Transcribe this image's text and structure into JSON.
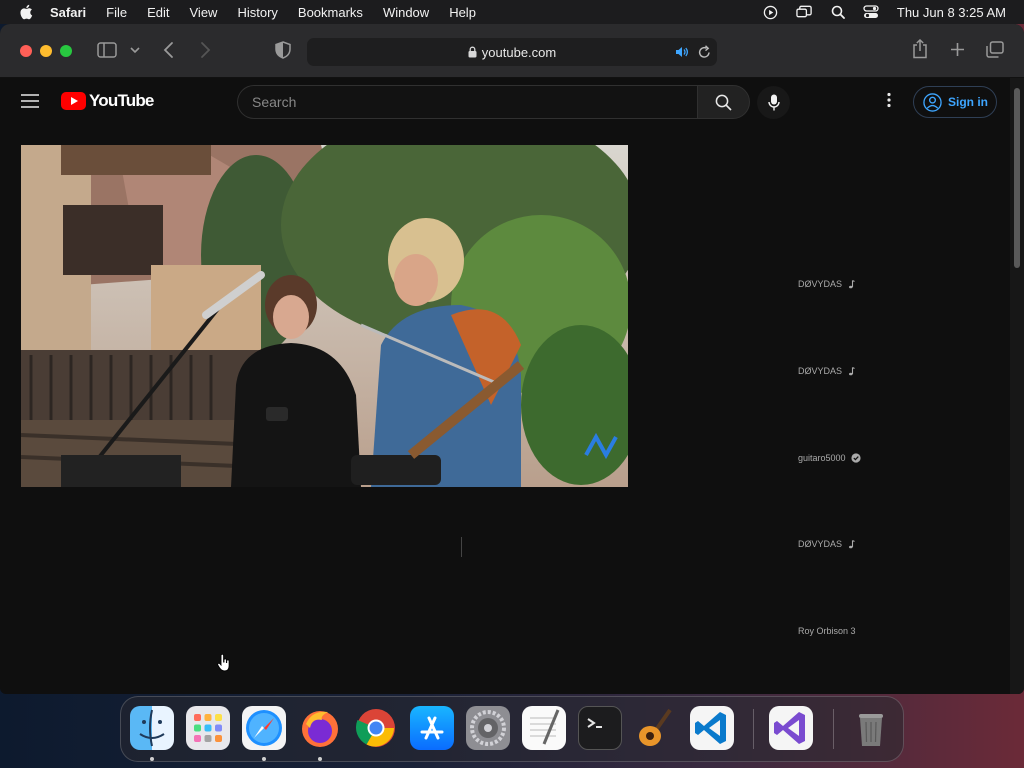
{
  "menubar": {
    "app": "Safari",
    "items": [
      "File",
      "Edit",
      "View",
      "History",
      "Bookmarks",
      "Window",
      "Help"
    ],
    "datetime": "Thu Jun 8  3:25 AM"
  },
  "browser": {
    "url": "youtube.com"
  },
  "youtube": {
    "logo_text": "YouTube",
    "search_placeholder": "Search",
    "signin_label": "Sign in",
    "recommendations": [
      {
        "channel": "DØVYDAS",
        "badge": "music-note-icon"
      },
      {
        "channel": "DØVYDAS",
        "badge": "music-note-icon"
      },
      {
        "channel": "guitaro5000",
        "badge": "verified-check-icon"
      },
      {
        "channel": "DØVYDAS",
        "badge": "music-note-icon"
      },
      {
        "channel": "Roy Orbison 3",
        "badge": ""
      }
    ]
  },
  "dock": {
    "apps": [
      "Finder",
      "Launchpad",
      "Safari",
      "Firefox",
      "Google Chrome",
      "App Store",
      "System Settings",
      "TextEdit",
      "Terminal",
      "GarageBand",
      "Visual Studio Code",
      "Visual Studio",
      "Trash"
    ]
  },
  "colors": {
    "youtube_red": "#ff0000",
    "signin_blue": "#3ea6ff",
    "page_bg": "#0f0f0f"
  }
}
